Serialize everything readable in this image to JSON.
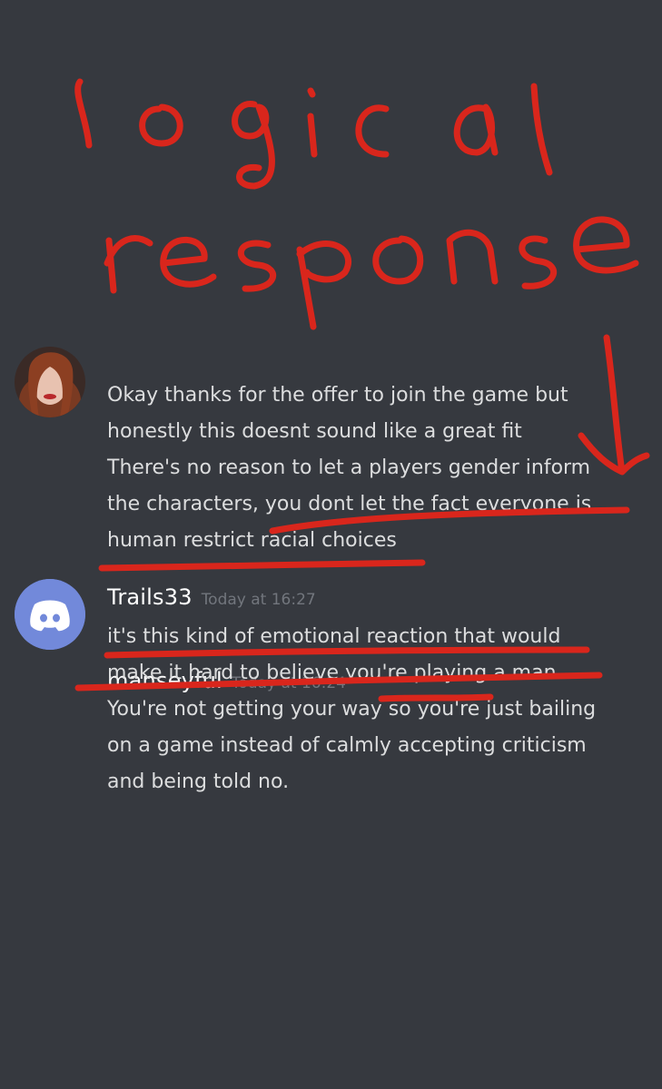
{
  "annotation": {
    "title_line1": "logical",
    "title_line2": "response",
    "color": "#d9261c"
  },
  "messages": [
    {
      "username": "manseyful",
      "timestamp": "Today at 16:24",
      "avatar": "user-photo-avatar",
      "lines": [
        "Okay thanks for the offer to join the game but",
        "honestly this doesnt sound like a great fit",
        "There's no reason to let a players gender inform",
        "the characters, you dont let the fact everyone is",
        "human restrict racial choices"
      ]
    },
    {
      "username": "Trails33",
      "timestamp": "Today at 16:27",
      "avatar": "discord-logo-avatar",
      "avatar_color": "#7289da",
      "lines": [
        "it's this kind of emotional reaction that would",
        "make it hard to believe you're playing a man.",
        "You're not getting your way so you're just bailing",
        "on a game instead of calmly accepting criticism",
        "and being told no."
      ]
    }
  ]
}
